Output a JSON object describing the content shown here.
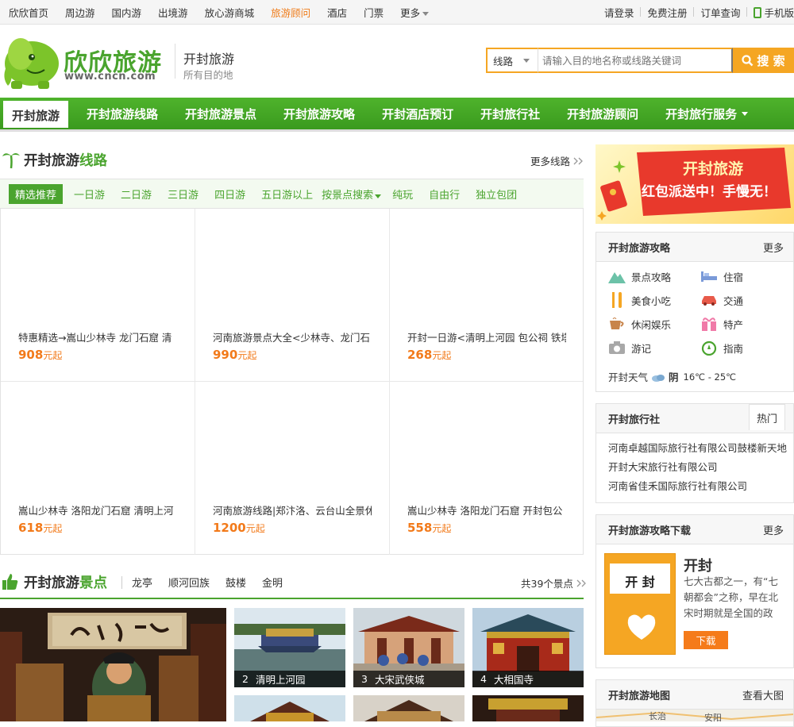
{
  "topbar": {
    "links": [
      "欣欣首页",
      "周边游",
      "国内游",
      "出境游",
      "放心游商城",
      "旅游顾问",
      "酒店",
      "门票"
    ],
    "active": "旅游顾问",
    "more": "更多",
    "login": "请登录",
    "register": "免费注册",
    "orders": "订单查询",
    "mobile": "手机版"
  },
  "header": {
    "logo_text": "欣欣旅游",
    "logo_url_text": "www.cncn.com",
    "city": "开封旅游",
    "city_sub": "所有目的地",
    "search_type": "线路",
    "search_placeholder": "请输入目的地名称或线路关键词",
    "search_button": "搜 索"
  },
  "nav": {
    "items": [
      "开封旅游",
      "开封旅游线路",
      "开封旅游景点",
      "开封旅游攻略",
      "开封酒店预订",
      "开封旅行社",
      "开封旅游顾问",
      "开封旅行服务"
    ],
    "active_index": 0
  },
  "routes": {
    "title_a": "开封旅游",
    "title_b": "线路",
    "more": "更多线路",
    "tabs": [
      "精选推荐",
      "一日游",
      "二日游",
      "三日游",
      "四日游",
      "五日游以上",
      "按景点搜索",
      "纯玩",
      "自由行",
      "独立包团"
    ],
    "items": [
      {
        "title": "特惠精选→嵩山少林寺  龙门石窟  清",
        "price": "908",
        "unit": "元起"
      },
      {
        "title": "河南旅游景点大全<少林寺、龙门石",
        "price": "990",
        "unit": "元起"
      },
      {
        "title": "开封一日游<清明上河园  包公祠  铁塔",
        "price": "268",
        "unit": "元起"
      },
      {
        "title": "嵩山少林寺  洛阳龙门石窟  清明上河",
        "price": "618",
        "unit": "元起"
      },
      {
        "title": "河南旅游线路|郑汴洛、云台山全景休",
        "price": "1200",
        "unit": "元起"
      },
      {
        "title": "嵩山少林寺  洛阳龙门石窟  开封包公",
        "price": "558",
        "unit": "元起"
      }
    ]
  },
  "banner": {
    "line1": "开封旅游",
    "line2": "红包派送中！手慢无！"
  },
  "guide": {
    "title": "开封旅游攻略",
    "more": "更多",
    "items": [
      "景点攻略",
      "住宿",
      "美食小吃",
      "交通",
      "休闲娱乐",
      "特产",
      "游记",
      "指南"
    ],
    "weather_label": "开封天气",
    "weather_cond": "阴",
    "weather_temp": "16℃ - 25℃"
  },
  "agency": {
    "title": "开封旅行社",
    "hot_tab": "热门",
    "items": [
      "河南卓越国际旅行社有限公司鼓楼新天地",
      "开封大宋旅行社有限公司",
      "河南省佳禾国际旅行社有限公司"
    ]
  },
  "download": {
    "title": "开封旅游攻略下载",
    "more": "更多",
    "cover_title": "开 封",
    "name": "开封",
    "desc": "七大古都之一，有“七朝都会”之称，早在北宋时期就是全国的政",
    "button": "下载"
  },
  "map": {
    "title": "开封旅游地图",
    "more": "查看大图",
    "labels": [
      "长治",
      "安阳"
    ]
  },
  "spots": {
    "title_a": "开封旅游",
    "title_b": "景点",
    "tags": [
      "龙亭",
      "顺河回族",
      "鼓楼",
      "金明"
    ],
    "count": "共39个景点",
    "items": [
      {
        "num": "2",
        "name": "清明上河园"
      },
      {
        "num": "3",
        "name": "大宋武侠城"
      },
      {
        "num": "4",
        "name": "大相国寺"
      }
    ]
  },
  "colors": {
    "brand_green": "#4aa42e",
    "accent_orange": "#f5a623",
    "price_orange": "#f27a1a"
  }
}
